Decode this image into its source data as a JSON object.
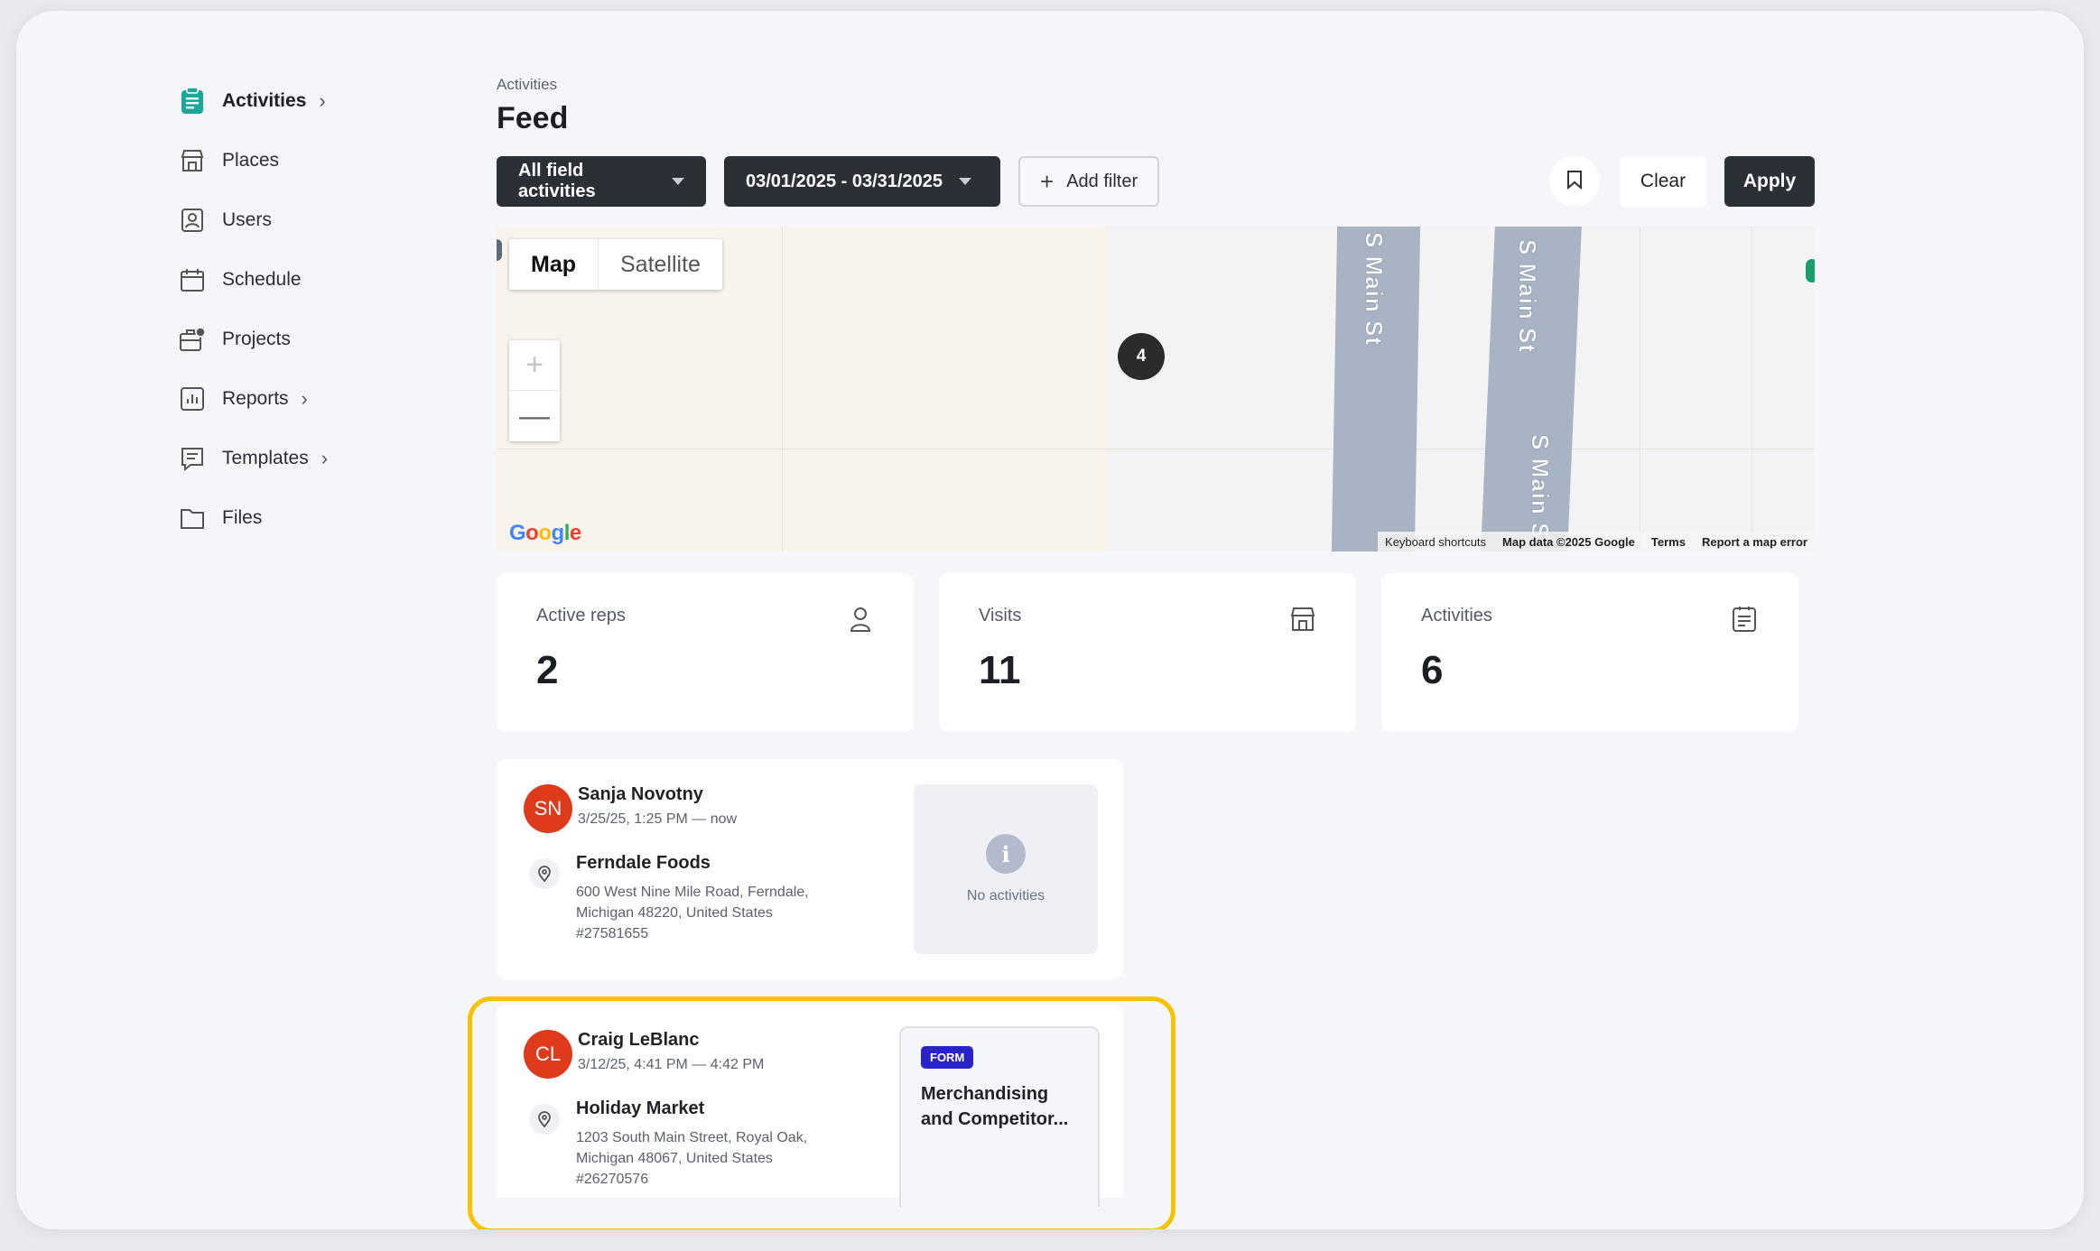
{
  "sidebar": {
    "items": [
      {
        "label": "Activities",
        "icon": "activities-icon",
        "active": true,
        "chevron": "›"
      },
      {
        "label": "Places",
        "icon": "store-icon"
      },
      {
        "label": "Users",
        "icon": "user-badge-icon"
      },
      {
        "label": "Schedule",
        "icon": "calendar-icon"
      },
      {
        "label": "Projects",
        "icon": "projects-icon"
      },
      {
        "label": "Reports",
        "icon": "reports-icon",
        "chevron": "›"
      },
      {
        "label": "Templates",
        "icon": "templates-icon",
        "chevron": "›"
      },
      {
        "label": "Files",
        "icon": "folder-icon"
      }
    ]
  },
  "header": {
    "breadcrumb": "Activities",
    "title": "Feed"
  },
  "filters": {
    "activity_type": "All field activities",
    "date_range": "03/01/2025 - 03/31/2025",
    "add_filter": "Add filter",
    "clear": "Clear",
    "apply": "Apply"
  },
  "map": {
    "type_map": "Map",
    "type_satellite": "Satellite",
    "zoom_in": "+",
    "zoom_out": "—",
    "cluster_count": "4",
    "road_label": "S Main St",
    "road_label_cut": "S Main S",
    "google": "Google",
    "attribution": {
      "shortcuts": "Keyboard shortcuts",
      "data": "Map data ©2025 Google",
      "terms": "Terms",
      "report": "Report a map error"
    }
  },
  "stats": [
    {
      "label": "Active reps",
      "value": "2",
      "icon": "user-icon"
    },
    {
      "label": "Visits",
      "value": "11",
      "icon": "store-icon"
    },
    {
      "label": "Activities",
      "value": "6",
      "icon": "activities-icon"
    }
  ],
  "visits": [
    {
      "initials": "SN",
      "name": "Sanja Novotny",
      "time": "3/25/25, 1:25 PM — now",
      "place": "Ferndale Foods",
      "address_line1": "600 West Nine Mile Road, Ferndale,",
      "address_line2": "Michigan 48220, United States",
      "place_id": "#27581655",
      "no_activities": "No activities",
      "info_glyph": "i"
    },
    {
      "initials": "CL",
      "name": "Craig LeBlanc",
      "time": "3/12/25, 4:41 PM — 4:42 PM",
      "place": "Holiday Market",
      "address_line1": "1203 South Main Street, Royal Oak,",
      "address_line2": "Michigan 48067, United States",
      "place_id": "#26270576",
      "activity_badge": "FORM",
      "activity_title": "Merchandising and Competitor..."
    }
  ],
  "colors": {
    "avatar": "#dd3b1c",
    "badge": "#2a23c8",
    "highlight": "#f7c300",
    "accent": "#19a06a"
  }
}
